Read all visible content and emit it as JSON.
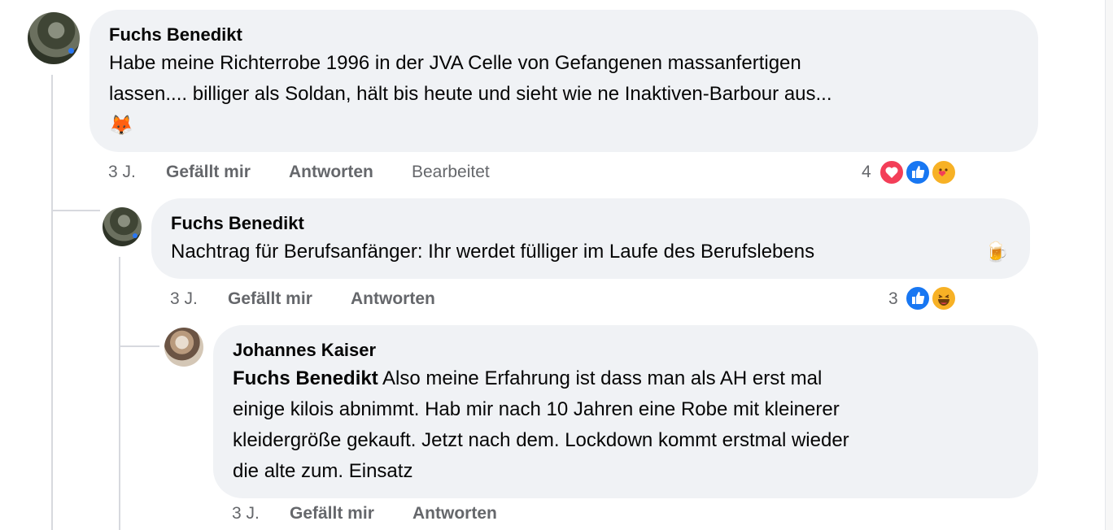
{
  "comments": [
    {
      "author": "Fuchs Benedikt",
      "lines": [
        "Habe meine Richterrobe 1996 in der JVA Celle von Gefangenen massanfertigen",
        "lassen.... billiger als Soldan, hält bis heute und sieht wie ne Inaktiven-Barbour aus...",
        ""
      ],
      "emoji": "🦊",
      "age": "3 J.",
      "like_label": "Gefällt mir",
      "reply_label": "Antworten",
      "edited_label": "Bearbeitet",
      "reaction_count": "4",
      "reactions": [
        "love",
        "like",
        "care"
      ]
    },
    {
      "author": "Fuchs Benedikt",
      "lines": [
        "Nachtrag für Berufsanfänger: Ihr werdet fülliger im Laufe des Berufslebens"
      ],
      "emoji": "🍺",
      "age": "3 J.",
      "like_label": "Gefällt mir",
      "reply_label": "Antworten",
      "reaction_count": "3",
      "reactions": [
        "like",
        "haha"
      ]
    },
    {
      "author": "Johannes Kaiser",
      "mention": "Fuchs Benedikt",
      "lines": [
        "Also meine Erfahrung ist dass man als AH erst mal",
        "einige kilois abnimmt. Hab mir nach 10 Jahren eine Robe mit kleinerer",
        "kleidergröße gekauft. Jetzt nach dem. Lockdown kommt erstmal wieder",
        "die alte zum. Einsatz"
      ],
      "age": "3 J.",
      "like_label": "Gefällt mir",
      "reply_label": "Antworten"
    }
  ],
  "colors": {
    "bubble": "#f0f2f5",
    "meta": "#65676b",
    "like": "#1877f2",
    "love": "#f33e58",
    "care": "#f7b125"
  }
}
